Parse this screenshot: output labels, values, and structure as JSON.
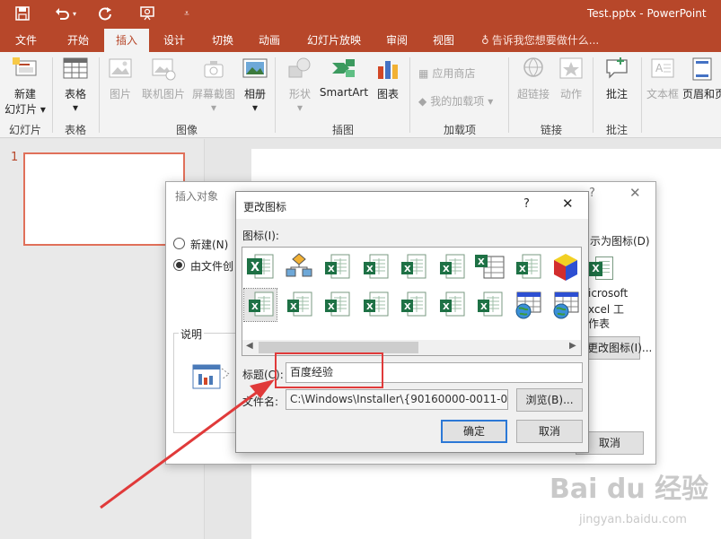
{
  "window": {
    "title": "Test.pptx - PowerPoint"
  },
  "tabs": [
    {
      "label": "文件"
    },
    {
      "label": "开始"
    },
    {
      "label": "插入"
    },
    {
      "label": "设计"
    },
    {
      "label": "切换"
    },
    {
      "label": "动画"
    },
    {
      "label": "幻灯片放映"
    },
    {
      "label": "审阅"
    },
    {
      "label": "视图"
    }
  ],
  "tellme": "告诉我您想要做什么...",
  "ribbon": {
    "new_slide": "新建",
    "new_slide2": "幻灯片",
    "table": "表格",
    "picture": "图片",
    "online_picture": "联机图片",
    "screenshot": "屏幕截图",
    "album": "相册",
    "shapes": "形状",
    "smartart": "SmartArt",
    "chart": "图表",
    "store": "应用商店",
    "my_addins": "我的加载项",
    "hyperlink": "超链接",
    "action": "动作",
    "comment": "批注",
    "textbox": "文本框",
    "header_footer": "页眉和页",
    "groups": {
      "slides": "幻灯片",
      "tables": "表格",
      "images": "图像",
      "illustrations": "插图",
      "addins": "加载项",
      "links": "链接",
      "comments": "批注"
    }
  },
  "thumbnails": {
    "slide_number": "1"
  },
  "insert_object": {
    "title": "插入对象",
    "help": "?",
    "create_new": "新建(N)",
    "from_file": "由文件创",
    "display_as_icon": "示为图标(D)",
    "icon_caption_1": "icrosoft",
    "icon_caption_2": "xcel 工",
    "icon_caption_3": "作表",
    "change_icon": "更改图标(I)...",
    "description_label": "说明",
    "cancel": "取消"
  },
  "change_icon": {
    "title": "更改图标",
    "help": "?",
    "icons_label": "图标(I):",
    "caption_label": "标题(C):",
    "caption_value": "百度经验",
    "filename_label": "文件名:",
    "filename_value": "C:\\Windows\\Installer\\{90160000-0011-000",
    "browse": "浏览(B)...",
    "ok": "确定",
    "cancel": "取消"
  },
  "watermark": {
    "brand": "Bai du 经验",
    "url": "jingyan.baidu.com"
  },
  "colors": {
    "accent": "#b7472a",
    "highlight": "#e03a3a",
    "excel_green": "#1e7145"
  }
}
